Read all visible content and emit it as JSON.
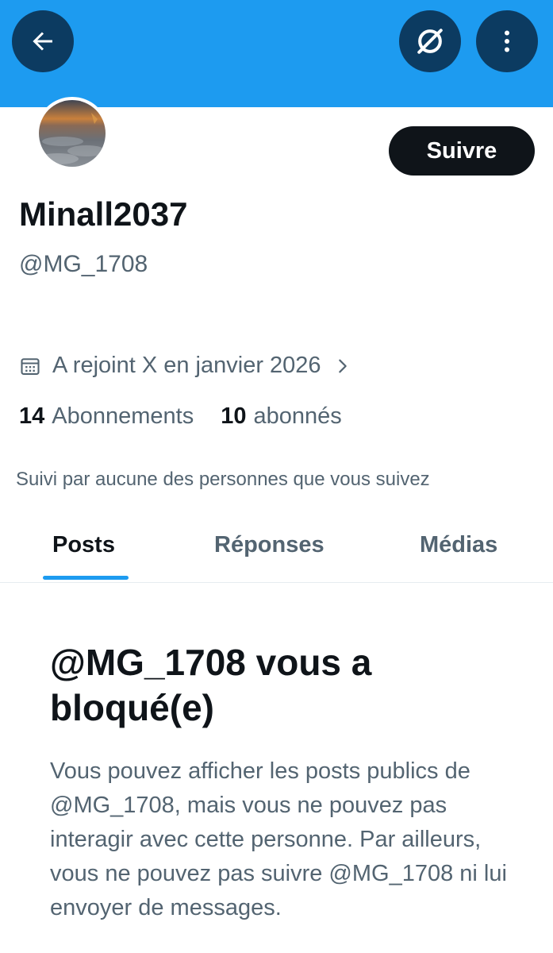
{
  "header": {
    "back_icon": "arrow-left-icon",
    "grok_icon": "grok-icon",
    "more_icon": "more-vertical-icon"
  },
  "profile": {
    "display_name": "Minall2037",
    "handle": "@MG_1708",
    "follow_label": "Suivre",
    "joined": "A rejoint X en janvier 2026",
    "following_count": "14",
    "following_label": "Abonnements",
    "followers_count": "10",
    "followers_label": "abonnés",
    "followed_by": "Suivi par aucune des personnes que vous suivez"
  },
  "tabs": [
    {
      "label": "Posts",
      "active": true
    },
    {
      "label": "Réponses",
      "active": false
    },
    {
      "label": "Médias",
      "active": false
    }
  ],
  "blocked": {
    "title": "@MG_1708 vous a bloqué(e)",
    "message": "Vous pouvez afficher les posts publics de @MG_1708, mais vous ne pouvez pas interagir avec cette personne. Par ailleurs, vous ne pouvez pas suivre @MG_1708 ni lui envoyer de messages."
  },
  "colors": {
    "banner": "#1d9bf0",
    "accent": "#1d9bf0",
    "button_dark": "#0f1419",
    "text_secondary": "#536471"
  }
}
